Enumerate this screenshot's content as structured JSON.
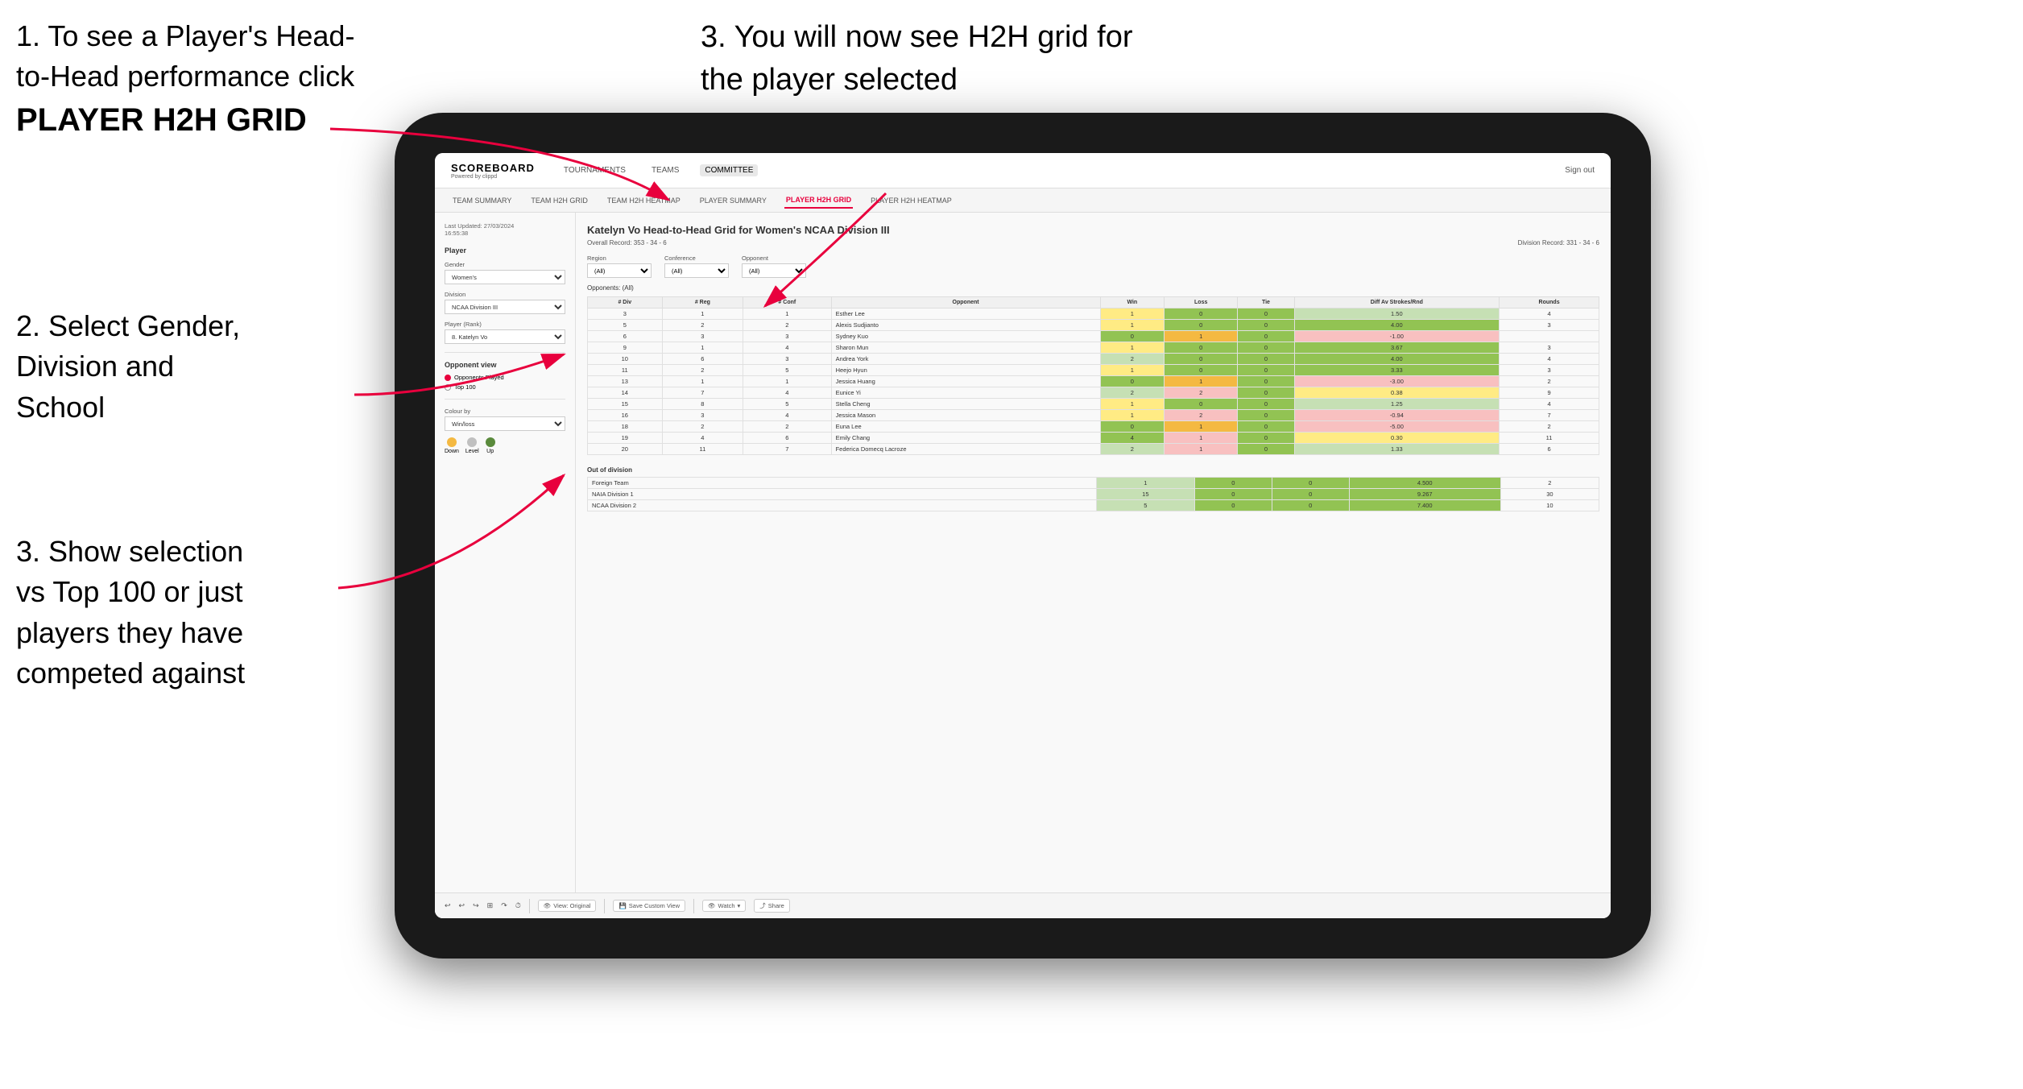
{
  "instructions": {
    "step1_line1": "1. To see a Player's Head-",
    "step1_line2": "to-Head performance click",
    "step1_bold": "PLAYER H2H GRID",
    "step2_title": "2. Select Gender,",
    "step2_line2": "Division and",
    "step2_line3": "School",
    "step3_top": "3. You will now see H2H grid for the player selected",
    "step3_bottom_title": "3. Show selection",
    "step3_bottom_line2": "vs Top 100 or just",
    "step3_bottom_line3": "players they have",
    "step3_bottom_line4": "competed against"
  },
  "nav": {
    "logo": "SCOREBOARD",
    "logo_sub": "Powered by clippd",
    "items": [
      "TOURNAMENTS",
      "TEAMS",
      "COMMITTEE"
    ],
    "active": "COMMITTEE",
    "sign_out": "Sign out"
  },
  "sub_nav": {
    "items": [
      "TEAM SUMMARY",
      "TEAM H2H GRID",
      "TEAM H2H HEATMAP",
      "PLAYER SUMMARY",
      "PLAYER H2H GRID",
      "PLAYER H2H HEATMAP"
    ],
    "active": "PLAYER H2H GRID"
  },
  "sidebar": {
    "timestamp": "Last Updated: 27/03/2024",
    "timestamp2": "16:55:38",
    "player_section": "Player",
    "gender_label": "Gender",
    "gender_value": "Women's",
    "division_label": "Division",
    "division_value": "NCAA Division III",
    "player_rank_label": "Player (Rank)",
    "player_rank_value": "8. Katelyn Vo",
    "opponent_view_label": "Opponent view",
    "radio_opponents": "Opponents Played",
    "radio_top100": "Top 100",
    "colour_by_label": "Colour by",
    "colour_by_value": "Win/loss",
    "legend_down": "Down",
    "legend_level": "Level",
    "legend_up": "Up"
  },
  "content": {
    "title": "Katelyn Vo Head-to-Head Grid for Women's NCAA Division III",
    "overall_record": "Overall Record: 353 - 34 - 6",
    "division_record": "Division Record: 331 - 34 - 6",
    "region_label": "Region",
    "conference_label": "Conference",
    "opponent_label": "Opponent",
    "opponents_label": "Opponents:",
    "filter_all": "(All)",
    "table_headers": [
      "# Div",
      "# Reg",
      "# Conf",
      "Opponent",
      "Win",
      "Loss",
      "Tie",
      "Diff Av Strokes/Rnd",
      "Rounds"
    ],
    "rows": [
      {
        "div": 3,
        "reg": 1,
        "conf": 1,
        "name": "Esther Lee",
        "win": 1,
        "loss": 0,
        "tie": 0,
        "diff": 1.5,
        "rounds": 4,
        "win_color": "yellow",
        "loss_color": "green",
        "tie_color": "green"
      },
      {
        "div": 5,
        "reg": 2,
        "conf": 2,
        "name": "Alexis Sudjianto",
        "win": 1,
        "loss": 0,
        "tie": 0,
        "diff": 4.0,
        "rounds": 3,
        "win_color": "yellow",
        "loss_color": "green",
        "tie_color": "green"
      },
      {
        "div": 6,
        "reg": 3,
        "conf": 3,
        "name": "Sydney Kuo",
        "win": 0,
        "loss": 1,
        "tie": 0,
        "diff": -1.0,
        "rounds": "",
        "win_color": "green",
        "loss_color": "orange",
        "tie_color": "green"
      },
      {
        "div": 9,
        "reg": 1,
        "conf": 4,
        "name": "Sharon Mun",
        "win": 1,
        "loss": 0,
        "tie": 0,
        "diff": 3.67,
        "rounds": 3,
        "win_color": "yellow",
        "loss_color": "green",
        "tie_color": "green"
      },
      {
        "div": 10,
        "reg": 6,
        "conf": 3,
        "name": "Andrea York",
        "win": 2,
        "loss": 0,
        "tie": 0,
        "diff": 4.0,
        "rounds": 4,
        "win_color": "green-light",
        "loss_color": "green",
        "tie_color": "green"
      },
      {
        "div": 11,
        "reg": 2,
        "conf": 5,
        "name": "Heejo Hyun",
        "win": 1,
        "loss": 0,
        "tie": 0,
        "diff": 3.33,
        "rounds": 3,
        "win_color": "yellow",
        "loss_color": "green",
        "tie_color": "green"
      },
      {
        "div": 13,
        "reg": 1,
        "conf": 1,
        "name": "Jessica Huang",
        "win": 0,
        "loss": 1,
        "tie": 0,
        "diff": -3.0,
        "rounds": 2,
        "win_color": "green",
        "loss_color": "orange",
        "tie_color": "green"
      },
      {
        "div": 14,
        "reg": 7,
        "conf": 4,
        "name": "Eunice Yi",
        "win": 2,
        "loss": 2,
        "tie": 0,
        "diff": 0.38,
        "rounds": 9,
        "win_color": "green-light",
        "loss_color": "pink",
        "tie_color": "green"
      },
      {
        "div": 15,
        "reg": 8,
        "conf": 5,
        "name": "Stella Cheng",
        "win": 1,
        "loss": 0,
        "tie": 0,
        "diff": 1.25,
        "rounds": 4,
        "win_color": "yellow",
        "loss_color": "green",
        "tie_color": "green"
      },
      {
        "div": 16,
        "reg": 3,
        "conf": 4,
        "name": "Jessica Mason",
        "win": 1,
        "loss": 2,
        "tie": 0,
        "diff": -0.94,
        "rounds": 7,
        "win_color": "yellow",
        "loss_color": "pink",
        "tie_color": "green"
      },
      {
        "div": 18,
        "reg": 2,
        "conf": 2,
        "name": "Euna Lee",
        "win": 0,
        "loss": 1,
        "tie": 0,
        "diff": -5.0,
        "rounds": 2,
        "win_color": "green",
        "loss_color": "orange",
        "tie_color": "green"
      },
      {
        "div": 19,
        "reg": 4,
        "conf": 6,
        "name": "Emily Chang",
        "win": 4,
        "loss": 1,
        "tie": 0,
        "diff": 0.3,
        "rounds": 11,
        "win_color": "green",
        "loss_color": "pink",
        "tie_color": "green"
      },
      {
        "div": 20,
        "reg": 11,
        "conf": 7,
        "name": "Federica Domecq Lacroze",
        "win": 2,
        "loss": 1,
        "tie": 0,
        "diff": 1.33,
        "rounds": 6,
        "win_color": "green-light",
        "loss_color": "pink",
        "tie_color": "green"
      }
    ],
    "out_of_division": "Out of division",
    "ood_rows": [
      {
        "name": "Foreign Team",
        "win": 1,
        "loss": 0,
        "tie": 0,
        "diff": 4.5,
        "rounds": 2
      },
      {
        "name": "NAIA Division 1",
        "win": 15,
        "loss": 0,
        "tie": 0,
        "diff": 9.267,
        "rounds": 30
      },
      {
        "name": "NCAA Division 2",
        "win": 5,
        "loss": 0,
        "tie": 0,
        "diff": 7.4,
        "rounds": 10
      }
    ]
  },
  "toolbar": {
    "undo": "↩",
    "redo": "↪",
    "view_original": "View: Original",
    "save_custom": "Save Custom View",
    "watch": "Watch",
    "share": "Share"
  },
  "colors": {
    "accent": "#e8003d",
    "green_dark": "#5a8a3c",
    "green": "#92c353",
    "green_light": "#c6e0b4",
    "yellow": "#ffeb84",
    "orange": "#f4b942",
    "pink": "#f8c0c0",
    "legend_down": "#f4b942",
    "legend_level": "#c0c0c0",
    "legend_up": "#5a8a3c"
  }
}
